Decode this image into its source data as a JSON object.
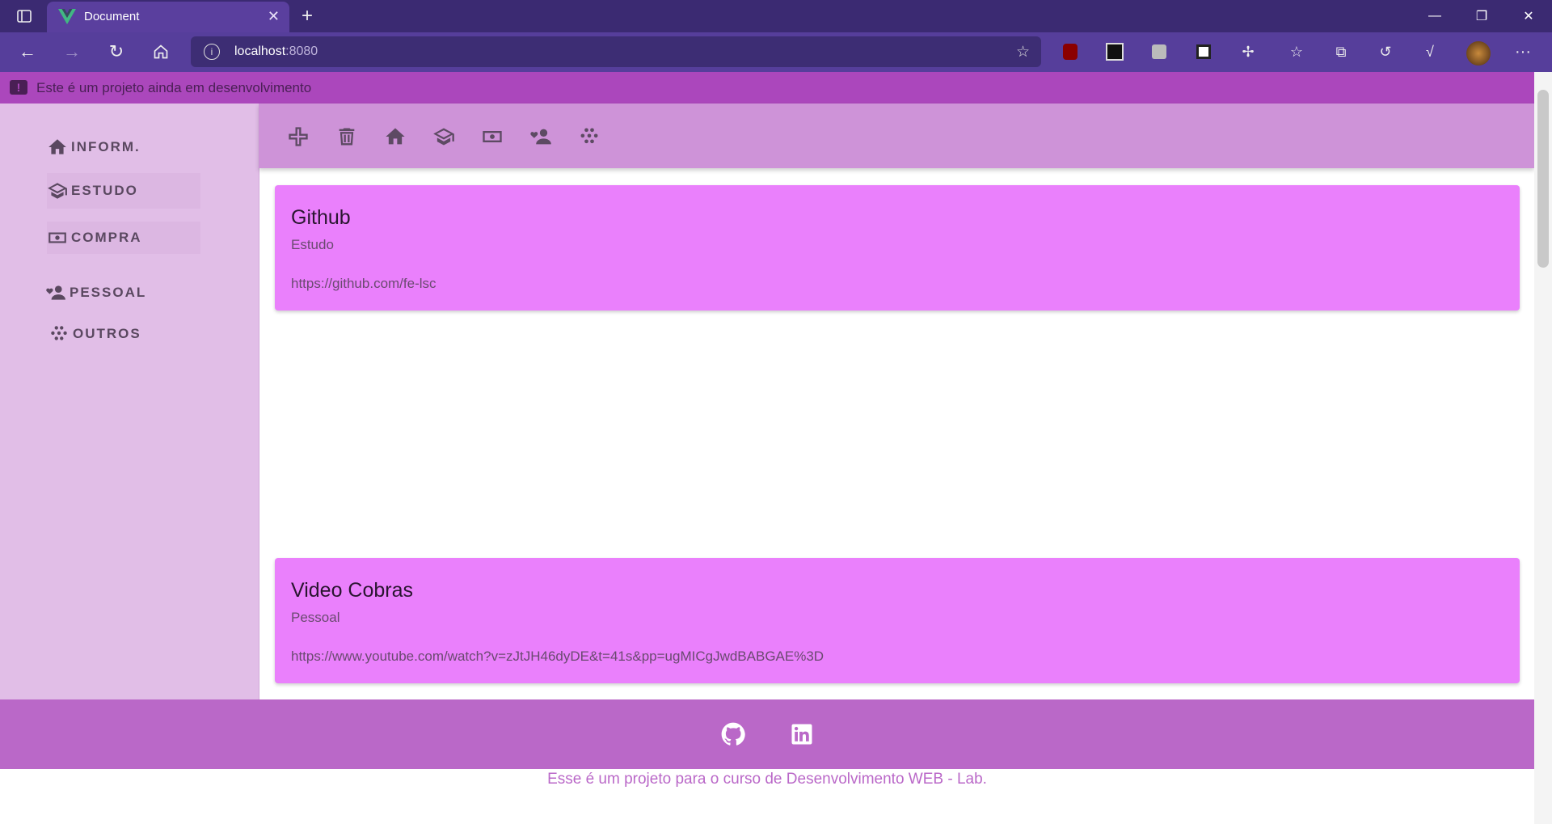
{
  "browser": {
    "tab_title": "Document",
    "url_host": "localhost",
    "url_port": ":8080"
  },
  "banner": {
    "text": "Este é um projeto ainda em desenvolvimento"
  },
  "sidebar": {
    "items": [
      {
        "label": "INFORM.",
        "icon": "home-icon"
      },
      {
        "label": "ESTUDO",
        "icon": "school-icon"
      },
      {
        "label": "COMPRA",
        "icon": "cash-icon"
      },
      {
        "label": "PESSOAL",
        "icon": "person-heart-icon"
      },
      {
        "label": "OUTROS",
        "icon": "dots-icon"
      }
    ]
  },
  "toolbar": {
    "icons": [
      "add-icon",
      "delete-icon",
      "home-icon",
      "school-icon",
      "cash-icon",
      "person-heart-icon",
      "dots-icon"
    ]
  },
  "cards": [
    {
      "title": "Github",
      "category": "Estudo",
      "url": "https://github.com/fe-lsc"
    },
    {
      "title": "Video Cobras",
      "category": "Pessoal",
      "url": "https://www.youtube.com/watch?v=zJtJH46dyDE&t=41s&pp=ugMICgJwdBABGAE%3D"
    }
  ],
  "footer": {
    "icons": [
      "github-icon",
      "linkedin-icon"
    ],
    "text": "Esse é um projeto para o curso de Desenvolvimento WEB - Lab."
  },
  "colors": {
    "banner": "#ab47bc",
    "sidebar": "#e1bee7",
    "topbar": "#ce93d8",
    "card": "#ea80fc",
    "footer": "#ba68c8"
  }
}
